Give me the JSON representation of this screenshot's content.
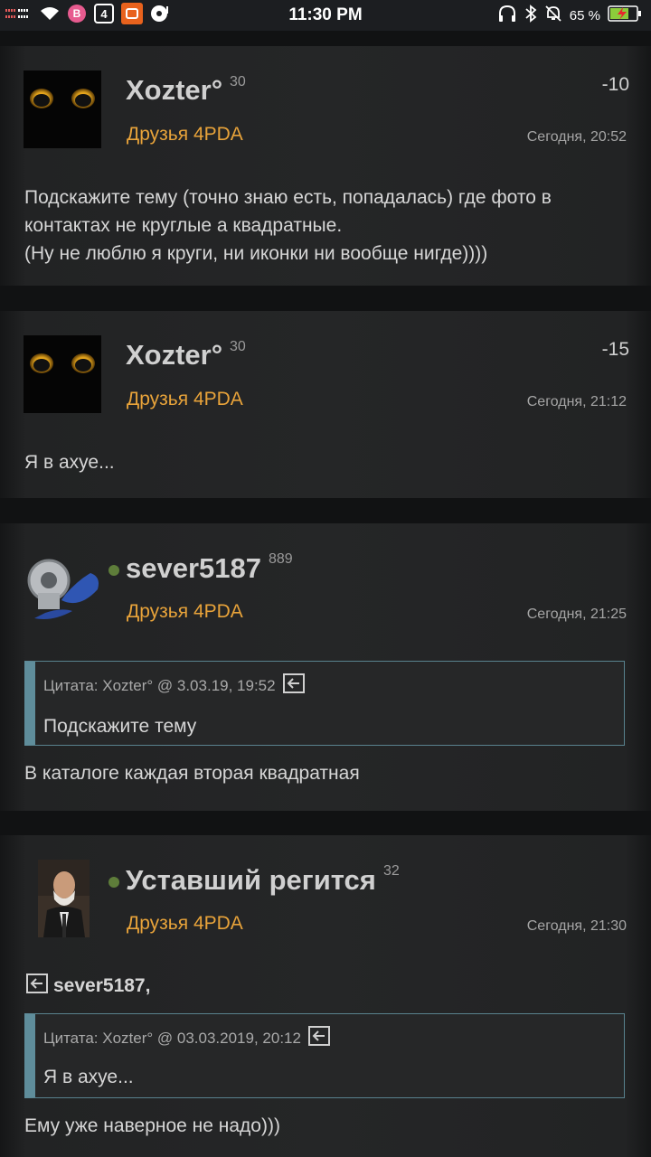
{
  "status_bar": {
    "time": "11:30 PM",
    "battery_percent": "65 %",
    "left_icons": [
      "signal-icon",
      "wifi-icon",
      "badge-b-icon",
      "app-4-icon",
      "app-orange-icon",
      "app-disc-icon"
    ],
    "right_icons": [
      "headphones-icon",
      "bluetooth-icon",
      "mute-bell-icon",
      "battery-charging-icon"
    ]
  },
  "posts": [
    {
      "author": "Xozter°",
      "reputation": "30",
      "group": "Друзья 4PDA",
      "score": "-10",
      "date": "Сегодня, 20:52",
      "text_lines": [
        "Подскажите тему (точно знаю есть, попадалась) где фото в",
        "контактах не круглые а квадратные.",
        "(Ну не люблю я круги, ни иконки ни вообще нигде))))"
      ]
    },
    {
      "author": "Xozter°",
      "reputation": "30",
      "group": "Друзья 4PDA",
      "score": "-15",
      "date": "Сегодня, 21:12",
      "text_lines": [
        "Я в ахуе..."
      ]
    },
    {
      "author": "sever5187",
      "reputation": "889",
      "group": "Друзья 4PDA",
      "date": "Сегодня, 21:25",
      "quote": {
        "header": "Цитата: Xozter° @ 3.03.19, 19:52",
        "text": "Подскажите тему"
      },
      "text_lines": [
        "В каталоге каждая вторая квадратная"
      ]
    },
    {
      "author": "Уставший регится",
      "reputation": "32",
      "group": "Друзья 4PDA",
      "date": "Сегодня, 21:30",
      "reply_to": "sever5187,",
      "quote": {
        "header": "Цитата: Xozter° @ 03.03.2019, 20:12",
        "text": "Я в ахуе..."
      },
      "text_lines": [
        "Ему уже наверное не надо)))"
      ]
    }
  ],
  "colors": {
    "group": "#e8a33a",
    "online": "#5e7d3a",
    "quote_border": "#5f8d9b"
  }
}
